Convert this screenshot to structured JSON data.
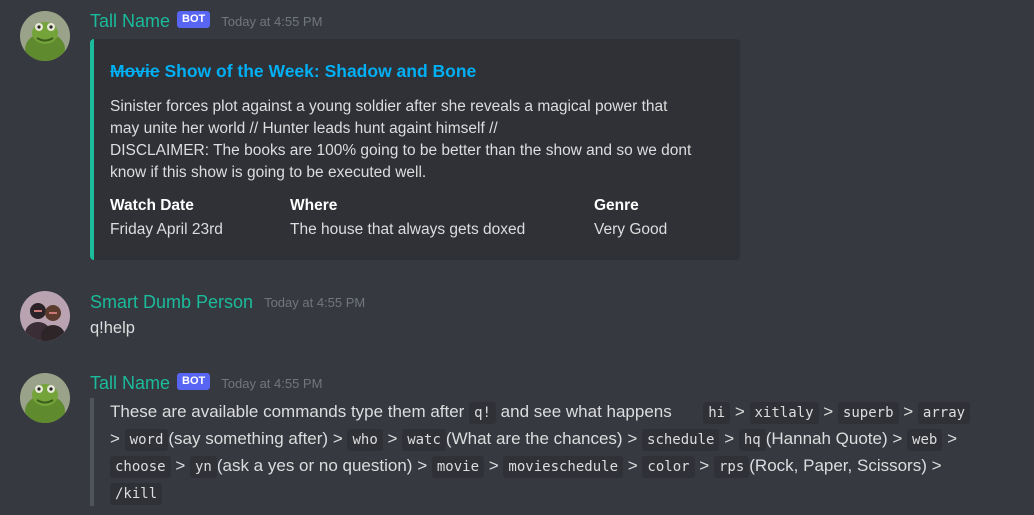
{
  "messages": [
    {
      "author": "Tall Name",
      "author_color": "#1abc9c",
      "bot_tag": "BOT",
      "timestamp": "Today at 4:55 PM",
      "avatar_icon": "kermit-frog-avatar",
      "embed": {
        "title_strike": "Movie",
        "title": "Show of the Week: Shadow and Bone",
        "description_lines": [
          "Sinister forces plot against a young soldier after she reveals a magical power that",
          "may unite her world // Hunter leads hunt againt himself //",
          "DISCLAIMER: The books are 100% going to be better than the show and so we dont",
          "know if this show is going to be executed well."
        ],
        "fields": [
          {
            "name": "Watch Date",
            "value": "Friday April 23rd"
          },
          {
            "name": "Where",
            "value": "The house that always gets doxed"
          },
          {
            "name": "Genre",
            "value": "Very Good"
          }
        ]
      }
    },
    {
      "author": "Smart Dumb Person",
      "author_color": "#1abc9c",
      "timestamp": "Today at 4:55 PM",
      "avatar_icon": "two-people-avatar",
      "content": "q!help"
    },
    {
      "author": "Tall Name",
      "author_color": "#1abc9c",
      "bot_tag": "BOT",
      "timestamp": "Today at 4:55 PM",
      "avatar_icon": "kermit-frog-avatar",
      "help": {
        "intro": "These are available commands type them after",
        "prefix": "q!",
        "intro_end": "and see what happens",
        "sep": ">",
        "commands": {
          "hi": "hi",
          "xitlaly": "xitlaly",
          "superb": "superb",
          "array": "array",
          "word": "word",
          "word_note": "(say something after)",
          "who": "who",
          "watc": "watc",
          "watc_note": "(What are the chances)",
          "schedule": "schedule",
          "hq": "hq",
          "hq_note": "(Hannah Quote)",
          "web": "web",
          "choose": "choose",
          "yn": "yn",
          "yn_note": "(ask a yes or no question)",
          "movie": "movie",
          "movieschedule": "movieschedule",
          "color": "color",
          "rps": "rps",
          "rps_note": "(Rock, Paper, Scissors)",
          "kill": "/kill"
        }
      }
    }
  ]
}
